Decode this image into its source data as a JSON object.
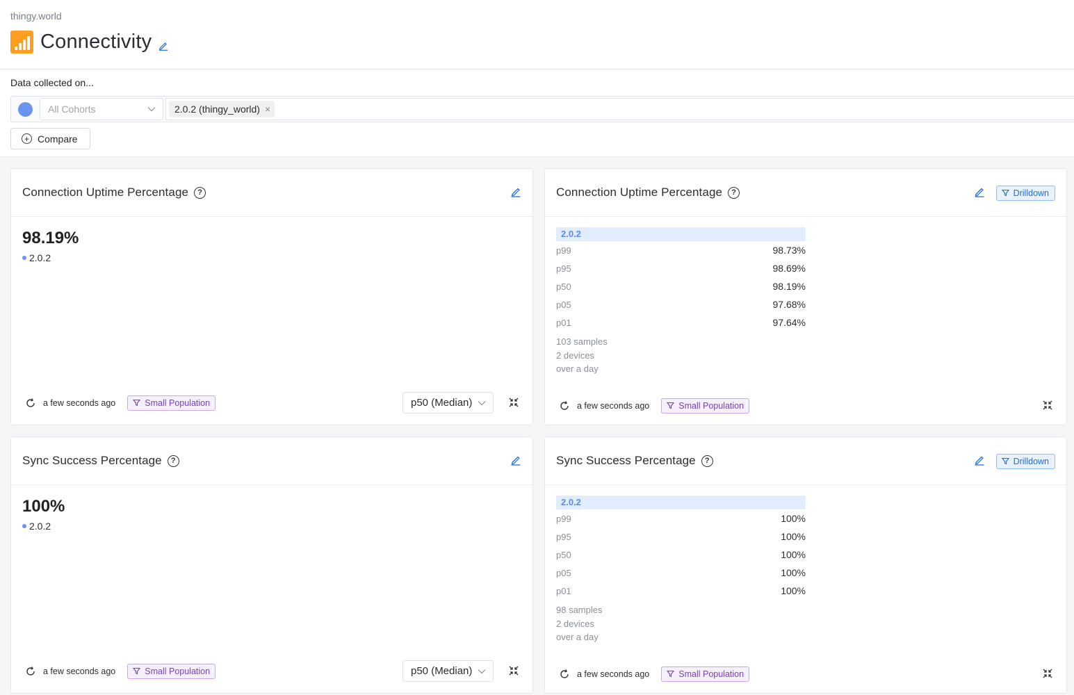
{
  "breadcrumb": "thingy.world",
  "page_title": "Connectivity",
  "filter": {
    "label": "Data collected on...",
    "cohort_placeholder": "All Cohorts",
    "tags": [
      "2.0.2 (thingy_world)"
    ],
    "tag_remove": "×",
    "compare_label": "Compare"
  },
  "colors": {
    "series": "#6b94f0",
    "accent": "#1f6fd6",
    "badge": "#7a3fc8"
  },
  "cards": [
    {
      "title": "Connection Uptime Percentage",
      "value": "98.19%",
      "series": "2.0.2",
      "footer": {
        "updated": "a few seconds ago",
        "badge": "Small Population",
        "aggregation": "p50 (Median)"
      }
    },
    {
      "title": "Connection Uptime Percentage",
      "drilldown": "Drilldown",
      "group": "2.0.2",
      "stats": [
        {
          "k": "p99",
          "v": "98.73%"
        },
        {
          "k": "p95",
          "v": "98.69%"
        },
        {
          "k": "p50",
          "v": "98.19%"
        },
        {
          "k": "p05",
          "v": "97.68%"
        },
        {
          "k": "p01",
          "v": "97.64%"
        }
      ],
      "samples": "103 samples",
      "devices": "2 devices",
      "period": "over a day",
      "footer": {
        "updated": "a few seconds ago",
        "badge": "Small Population"
      }
    },
    {
      "title": "Sync Success Percentage",
      "value": "100%",
      "series": "2.0.2",
      "footer": {
        "updated": "a few seconds ago",
        "badge": "Small Population",
        "aggregation": "p50 (Median)"
      }
    },
    {
      "title": "Sync Success Percentage",
      "drilldown": "Drilldown",
      "group": "2.0.2",
      "stats": [
        {
          "k": "p99",
          "v": "100%"
        },
        {
          "k": "p95",
          "v": "100%"
        },
        {
          "k": "p50",
          "v": "100%"
        },
        {
          "k": "p05",
          "v": "100%"
        },
        {
          "k": "p01",
          "v": "100%"
        }
      ],
      "samples": "98 samples",
      "devices": "2 devices",
      "period": "over a day",
      "footer": {
        "updated": "a few seconds ago",
        "badge": "Small Population"
      }
    }
  ]
}
